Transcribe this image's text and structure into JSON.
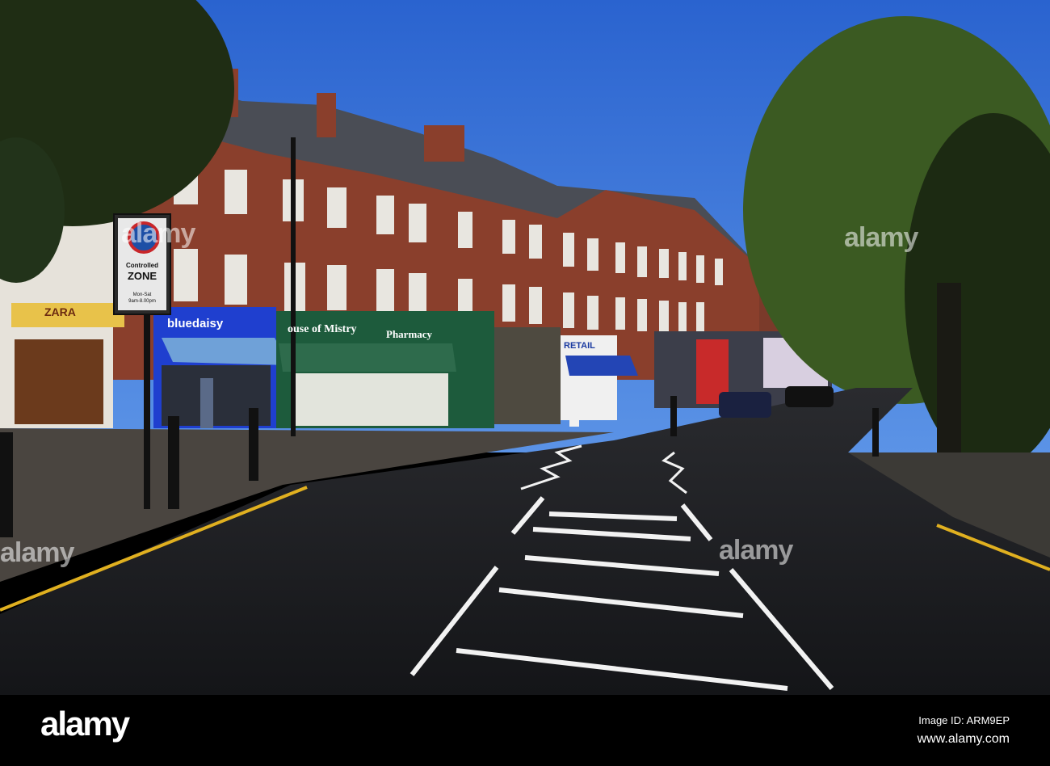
{
  "photo": {
    "signs": {
      "zara": "ZARA",
      "controlled_zone": {
        "line1": "Controlled",
        "line2": "ZONE",
        "line3": "Mon-Sat",
        "line4": "9am-8.00pm"
      },
      "bluedaisy": "bluedaisy",
      "house_of_mistry": "ouse of Mistry",
      "pharmacy": "Pharmacy",
      "retail": "RETAIL"
    },
    "colors": {
      "sky": "#2f6fd6",
      "brick": "#8a3f2c",
      "road": "#1c1d20",
      "shop_blue": "#1f3fcf",
      "shop_green": "#1d5b3c"
    }
  },
  "watermark": {
    "text": "alamy"
  },
  "footer": {
    "logo": "alamy",
    "image_id": "Image ID: ARM9EP",
    "url": "www.alamy.com"
  }
}
